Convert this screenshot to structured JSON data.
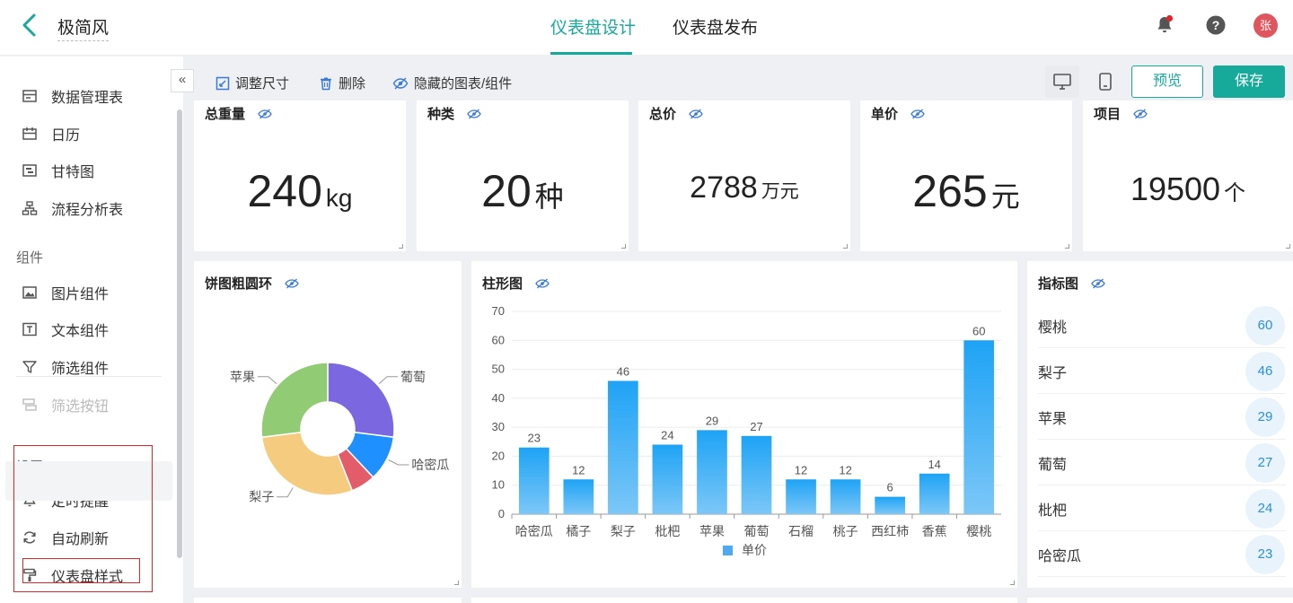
{
  "header": {
    "app_title": "极简风",
    "tabs": [
      {
        "label": "仪表盘设计",
        "active": true
      },
      {
        "label": "仪表盘发布",
        "active": false
      }
    ],
    "avatar": "张",
    "accent": "#17a99a"
  },
  "sidebar": {
    "items": [
      {
        "label": "数据管理表",
        "icon": "table-icon"
      },
      {
        "label": "日历",
        "icon": "calendar-icon"
      },
      {
        "label": "甘特图",
        "icon": "gantt-icon"
      },
      {
        "label": "流程分析表",
        "icon": "flow-icon"
      }
    ],
    "components_title": "组件",
    "components": [
      {
        "label": "图片组件",
        "icon": "image-icon"
      },
      {
        "label": "文本组件",
        "icon": "text-icon"
      },
      {
        "label": "筛选组件",
        "icon": "filter-icon"
      },
      {
        "label": "筛选按钮",
        "icon": "filter-button-icon",
        "disabled": true
      }
    ],
    "settings_title": "设置",
    "settings": [
      {
        "label": "定时提醒",
        "icon": "bell-icon"
      },
      {
        "label": "自动刷新",
        "icon": "refresh-icon"
      },
      {
        "label": "仪表盘样式",
        "icon": "paint-roller-icon"
      }
    ]
  },
  "toolbar": {
    "resize": "调整尺寸",
    "delete": "删除",
    "hidden": "隐藏的图表/组件",
    "preview": "预览",
    "save": "保存"
  },
  "kpis": [
    {
      "title": "总重量",
      "value": "240",
      "unit": "kg"
    },
    {
      "title": "种类",
      "value": "20",
      "unit": "种"
    },
    {
      "title": "总价",
      "value": "2788",
      "unit": "万元"
    },
    {
      "title": "单价",
      "value": "265",
      "unit": "元"
    },
    {
      "title": "项目",
      "value": "19500",
      "unit": "个"
    }
  ],
  "chart_data": [
    {
      "type": "pie",
      "title": "饼图粗圆环",
      "slices": [
        {
          "label": "葡萄",
          "value": 27,
          "color": "#7b68e0"
        },
        {
          "label": "哈密瓜",
          "value": 11,
          "color": "#1e90ff"
        },
        {
          "label": "",
          "value": 6,
          "color": "#e25c6a"
        },
        {
          "label": "梨子",
          "value": 29,
          "color": "#f5cc7f"
        },
        {
          "label": "苹果",
          "value": 27,
          "color": "#91cb74"
        }
      ]
    },
    {
      "type": "bar",
      "title": "柱形图",
      "categories": [
        "哈密瓜",
        "橘子",
        "梨子",
        "枇杷",
        "苹果",
        "葡萄",
        "石榴",
        "桃子",
        "西红柿",
        "香蕉",
        "樱桃"
      ],
      "series": [
        {
          "name": "单价",
          "values": [
            23,
            12,
            46,
            24,
            29,
            27,
            12,
            12,
            6,
            14,
            60
          ]
        }
      ],
      "ylim": [
        0,
        70
      ],
      "yticks": [
        0,
        10,
        20,
        30,
        40,
        50,
        60,
        70
      ],
      "grid": true,
      "legend": "bottom"
    }
  ],
  "indicator": {
    "title": "指标图",
    "rows": [
      {
        "label": "樱桃",
        "value": "60"
      },
      {
        "label": "梨子",
        "value": "46"
      },
      {
        "label": "苹果",
        "value": "29"
      },
      {
        "label": "葡萄",
        "value": "27"
      },
      {
        "label": "枇杷",
        "value": "24"
      },
      {
        "label": "哈密瓜",
        "value": "23"
      }
    ]
  }
}
